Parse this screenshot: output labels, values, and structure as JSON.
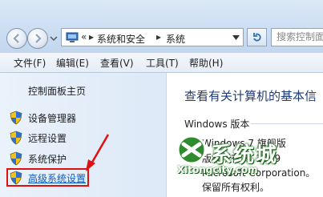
{
  "address_bar": {
    "overflow": "«",
    "breadcrumbs": [
      "系统和安全",
      "系统"
    ],
    "separator": "▸"
  },
  "search": {
    "placeholder": "搜索控制面板"
  },
  "menu": [
    "文件(F)",
    "编辑(E)",
    "查看(V)",
    "工具(T)",
    "帮助(H)"
  ],
  "left_pane": {
    "home_link": "控制面板主页",
    "tasks": [
      "设备管理器",
      "远程设置",
      "系统保护",
      "高级系统设置"
    ]
  },
  "main": {
    "title": "查看有关计算机的基本信",
    "section_label": "Windows 版本",
    "edition": "Windows 7 旗舰版",
    "copyright": "版权所有 © 2009",
    "company": "Microsoft Corporation。",
    "rights": "保留所有权利。"
  },
  "watermark": {
    "cn": "系统城",
    "en": "Xitongcity.com"
  },
  "colors": {
    "highlight_box": "#dd1111",
    "link": "#0b5cbf",
    "title": "#1f3b7a",
    "watermark_green": "#2e8b2e"
  }
}
